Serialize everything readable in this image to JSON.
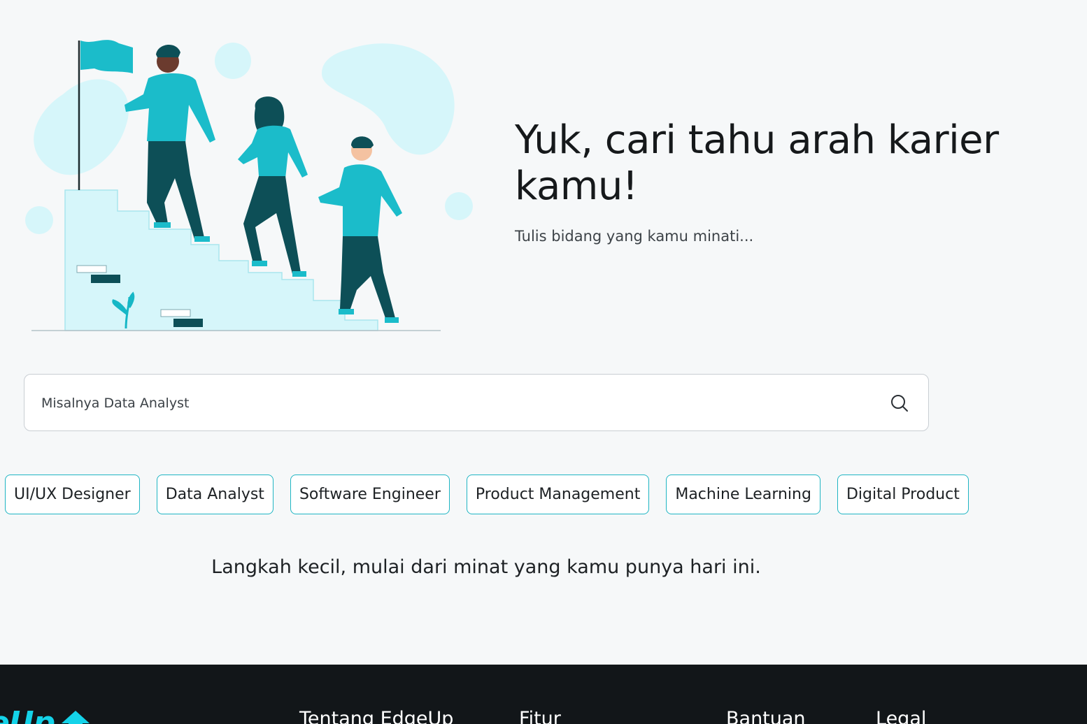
{
  "hero": {
    "title": "Yuk, cari tahu arah karier kamu!",
    "subtitle": "Tulis bidang yang kamu minati..."
  },
  "search": {
    "placeholder": "Misalnya Data Analyst",
    "value": "",
    "icon": "search-icon"
  },
  "chips": [
    {
      "label": "UI/UX Designer"
    },
    {
      "label": "Data Analyst"
    },
    {
      "label": "Software Engineer"
    },
    {
      "label": "Product Management"
    },
    {
      "label": "Machine Learning"
    },
    {
      "label": "Digital Product"
    }
  ],
  "tagline": "Langkah kecil, mulai dari minat yang kamu punya hari ini.",
  "footer": {
    "logo_text": "eUp",
    "links": [
      {
        "label": "Tentang EdgeUp"
      },
      {
        "label": "Fitur"
      },
      {
        "label": "Bantuan"
      },
      {
        "label": "Legal"
      }
    ]
  },
  "colors": {
    "accent": "#1fb5c3",
    "background": "#f6f8f9",
    "footer_background": "#121619",
    "logo": "#14d3e9"
  }
}
